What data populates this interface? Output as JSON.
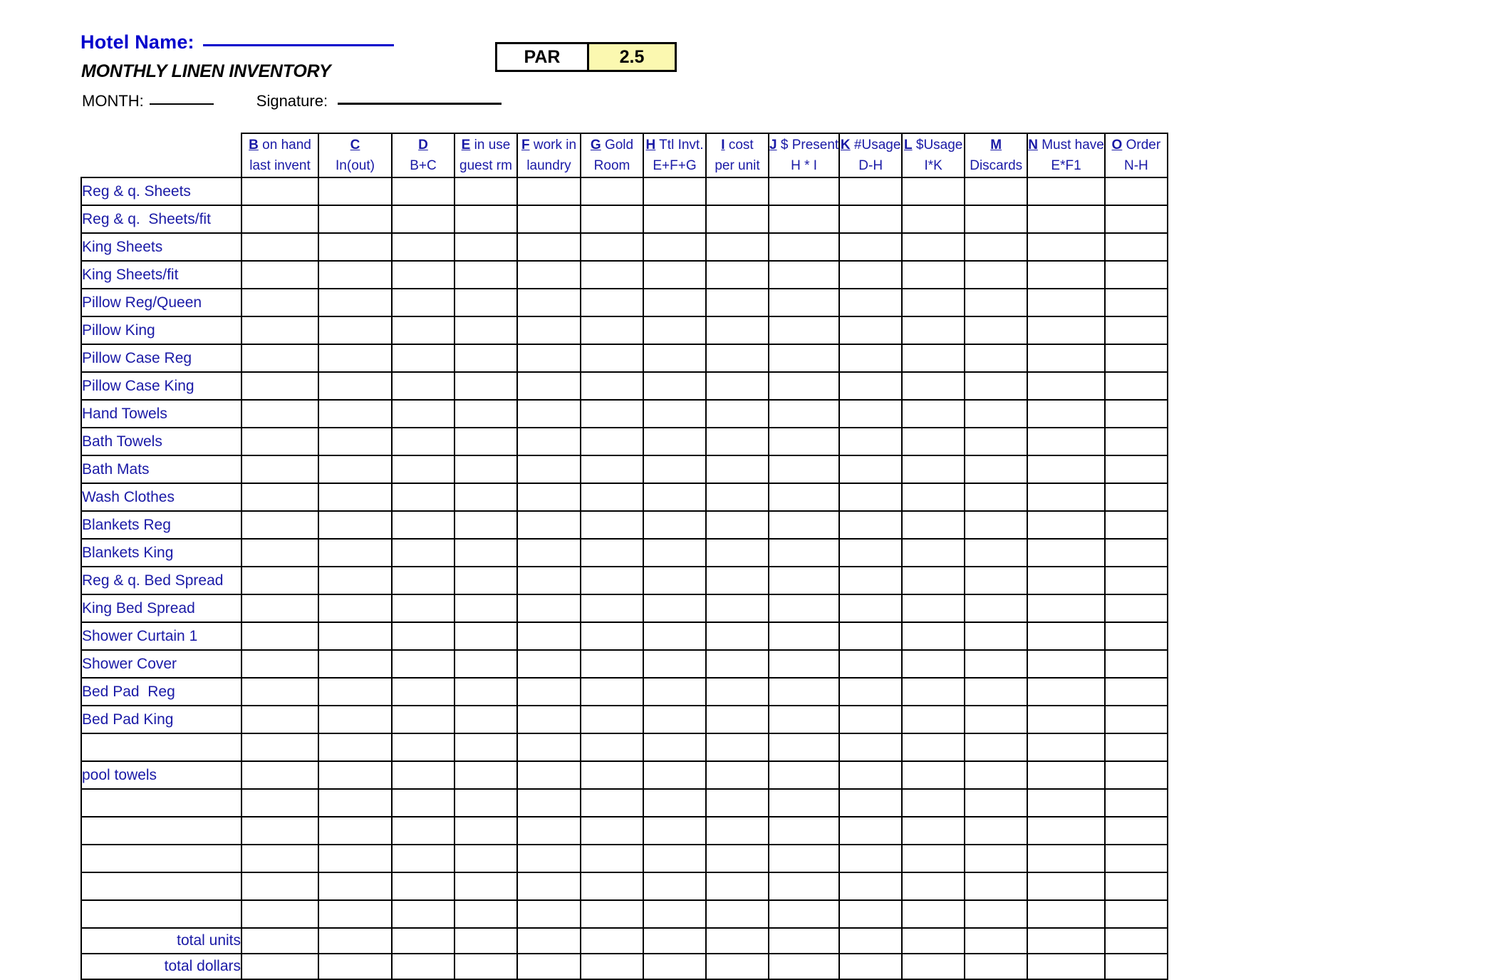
{
  "header": {
    "hotel_name_label": "Hotel Name:",
    "hotel_name_value": "",
    "subtitle": "MONTHLY LINEN INVENTORY",
    "month_label": "MONTH:",
    "month_value": "",
    "signature_label": "Signature:",
    "signature_value": "",
    "par": {
      "label": "PAR",
      "value": "2.5"
    }
  },
  "colors": {
    "input_yellow": "#fbf8b0",
    "text_blue": "#1a1aa6",
    "heading_blue": "#0000cc",
    "blocked_black": "#000000"
  },
  "table": {
    "columns": [
      {
        "letter": "B",
        "line1_rest": " on hand",
        "line2": "last invent",
        "fill": "yellow"
      },
      {
        "letter": "C",
        "line1_rest": "",
        "line2": "In(out)",
        "fill": "yellow"
      },
      {
        "letter": "D",
        "line1_rest": "",
        "line2": "B+C",
        "fill": "white"
      },
      {
        "letter": "E",
        "line1_rest": " in use",
        "line2": "guest rm",
        "fill": "yellow"
      },
      {
        "letter": "F",
        "line1_rest": " work in",
        "line2": "laundry",
        "fill": "yellow"
      },
      {
        "letter": "G",
        "line1_rest": " Gold",
        "line2": "Room",
        "fill": "yellow"
      },
      {
        "letter": "H",
        "line1_rest": " Ttl Invt.",
        "line2": "E+F+G",
        "fill": "white"
      },
      {
        "letter": "I",
        "line1_rest": " cost",
        "line2": "per unit",
        "fill": "yellow"
      },
      {
        "letter": "J",
        "line1_rest": " $ Present",
        "line2": "H * I",
        "fill": "white"
      },
      {
        "letter": "K",
        "line1_rest": " #Usage",
        "line2": "D-H",
        "fill": "white"
      },
      {
        "letter": "L",
        "line1_rest": " $Usage",
        "line2": "I*K",
        "fill": "white"
      },
      {
        "letter": "M",
        "line1_rest": "",
        "line2": "Discards",
        "fill": "yellow"
      },
      {
        "letter": "N",
        "line1_rest": " Must have",
        "line2": "E*F1",
        "fill": "white"
      },
      {
        "letter": "O",
        "line1_rest": " Order",
        "line2": "N-H",
        "fill": "white"
      }
    ],
    "rows": [
      {
        "label": "Reg & q. Sheets"
      },
      {
        "label": "Reg & q.  Sheets/fit"
      },
      {
        "label": "King Sheets"
      },
      {
        "label": "King Sheets/fit"
      },
      {
        "label": "Pillow Reg/Queen"
      },
      {
        "label": "Pillow King"
      },
      {
        "label": "Pillow Case Reg"
      },
      {
        "label": "Pillow Case King"
      },
      {
        "label": "Hand Towels"
      },
      {
        "label": "Bath Towels"
      },
      {
        "label": "Bath Mats"
      },
      {
        "label": "Wash Clothes"
      },
      {
        "label": "Blankets Reg"
      },
      {
        "label": "Blankets King"
      },
      {
        "label": "Reg & q. Bed Spread"
      },
      {
        "label": "King Bed Spread"
      },
      {
        "label": "Shower Curtain 1"
      },
      {
        "label": "Shower Cover"
      },
      {
        "label": "Bed Pad  Reg"
      },
      {
        "label": "Bed Pad King"
      },
      {
        "label": ""
      },
      {
        "label": "pool towels"
      },
      {
        "label": ""
      },
      {
        "label": ""
      },
      {
        "label": ""
      },
      {
        "label": ""
      },
      {
        "label": ""
      }
    ],
    "totals": [
      {
        "label": "total units",
        "cells": [
          "white",
          "yellow",
          "yellow",
          "white",
          "white",
          "white",
          "white",
          "black",
          "black",
          "white",
          "black",
          "white",
          "white",
          "white"
        ]
      },
      {
        "label": "total dollars",
        "cells": [
          "black",
          "black",
          "black",
          "black",
          "black",
          "black",
          "black",
          "black",
          "white",
          "black",
          "white",
          "black",
          "black",
          "black"
        ]
      }
    ]
  }
}
